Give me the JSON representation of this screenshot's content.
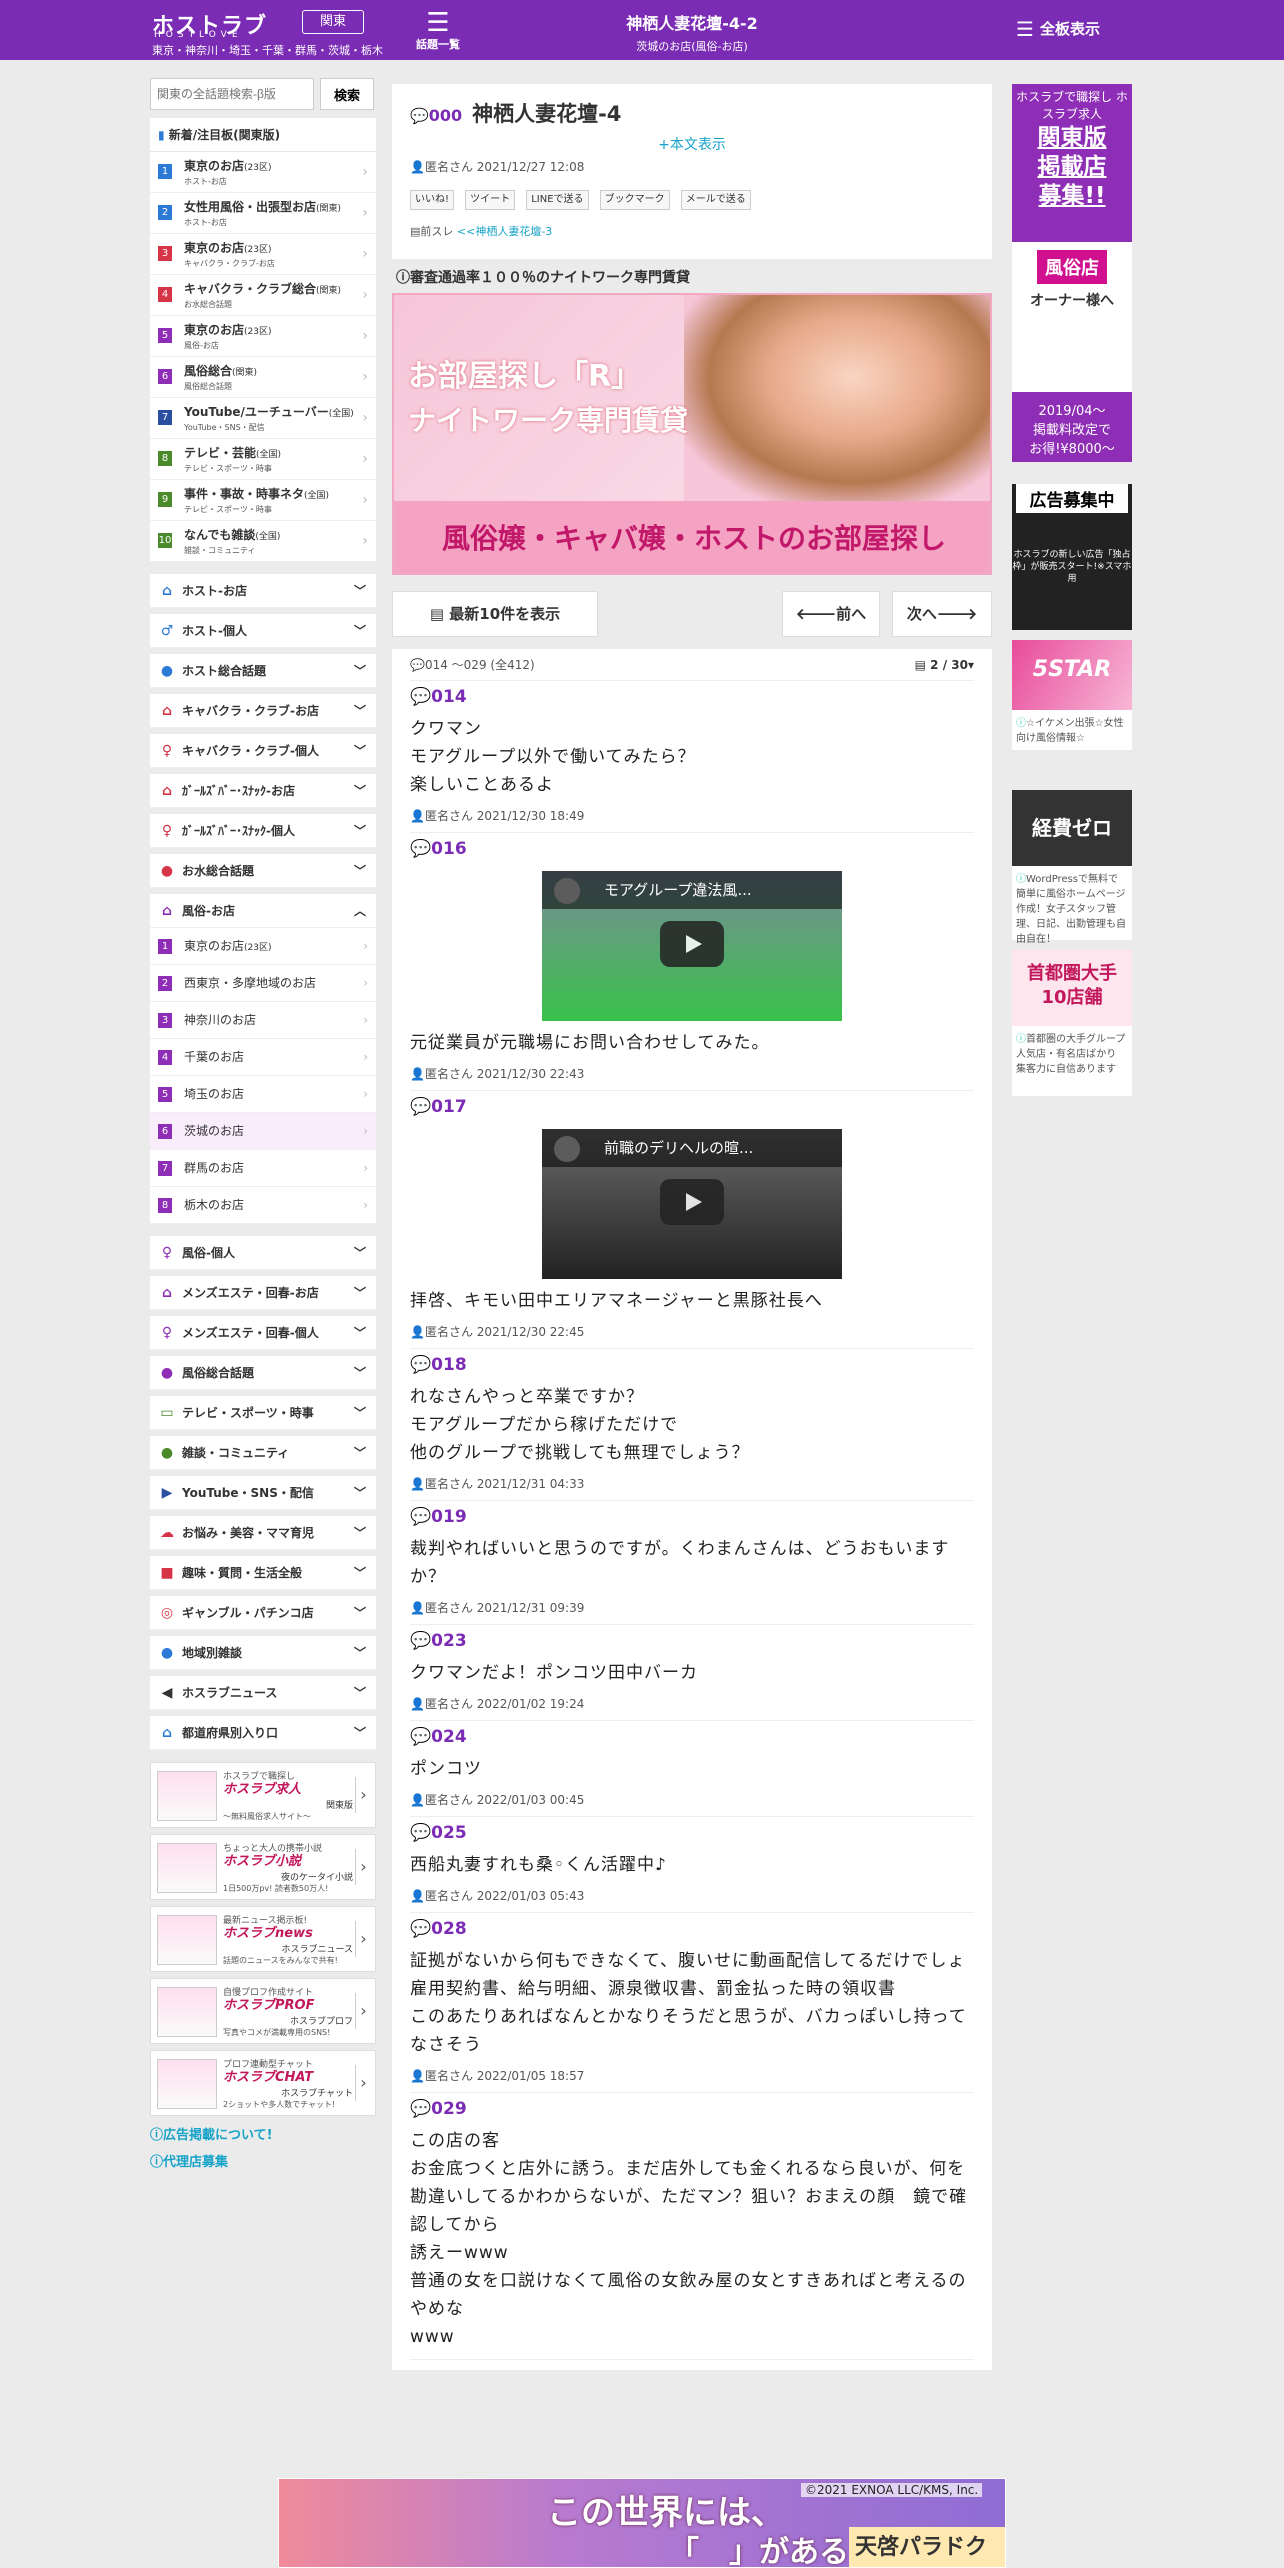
{
  "header": {
    "logo": "ホストラブ",
    "logo_sub": "HOSTLOVE",
    "region": "関東",
    "areas": "東京・神奈川・埼玉・千葉・群馬・茨城・栃木",
    "topics_label": "話題一覧",
    "page_title": "神栖人妻花壇-4-2",
    "page_subtitle": "茨城のお店(風俗-お店)",
    "full_label": "全板表示",
    "bg_color": "#7b2cb4"
  },
  "sidebar": {
    "search_placeholder": "関東の全話題検索-β版",
    "search_button": "検索",
    "hot_title": "新着/注目板(関東版)",
    "hot_items": [
      {
        "num": "1",
        "name": "東京のお店",
        "small": "(23区)",
        "desc": "ホスト-お店",
        "color": "#2a7ad6"
      },
      {
        "num": "2",
        "name": "女性用風俗・出張型お店",
        "small": "(関東)",
        "desc": "ホスト-お店",
        "color": "#2a7ad6"
      },
      {
        "num": "3",
        "name": "東京のお店",
        "small": "(23区)",
        "desc": "キャバクラ・クラブ-お店",
        "color": "#d63447"
      },
      {
        "num": "4",
        "name": "キャバクラ・クラブ総合",
        "small": "(関東)",
        "desc": "お水総合話題",
        "color": "#d63447"
      },
      {
        "num": "5",
        "name": "東京のお店",
        "small": "(23区)",
        "desc": "風俗-お店",
        "color": "#8e2db5"
      },
      {
        "num": "6",
        "name": "風俗総合",
        "small": "(関東)",
        "desc": "風俗総合話題",
        "color": "#8e2db5"
      },
      {
        "num": "7",
        "name": "YouTube/ユーチューバー",
        "small": "(全国)",
        "desc": "YouTube・SNS・配信",
        "color": "#2a4fa0"
      },
      {
        "num": "8",
        "name": "テレビ・芸能",
        "small": "(全国)",
        "desc": "テレビ・スポーツ・時事",
        "color": "#4b8a2a"
      },
      {
        "num": "9",
        "name": "事件・事故・時事ネタ",
        "small": "(全国)",
        "desc": "テレビ・スポーツ・時事",
        "color": "#4b8a2a"
      },
      {
        "num": "10",
        "name": "なんでも雑談",
        "small": "(全国)",
        "desc": "雑談・コミュニティ",
        "color": "#4b8a2a"
      }
    ],
    "cats_a": [
      {
        "name": "ホスト-お店",
        "icon": "⌂",
        "color": "#2a7ad6"
      },
      {
        "name": "ホスト-個人",
        "icon": "♂",
        "color": "#2a7ad6"
      },
      {
        "name": "ホスト総合話題",
        "icon": "●",
        "color": "#2a7ad6"
      },
      {
        "name": "キャバクラ・クラブ-お店",
        "icon": "⌂",
        "color": "#d63447"
      },
      {
        "name": "キャバクラ・クラブ-個人",
        "icon": "♀",
        "color": "#d63447"
      },
      {
        "name": "ｶﾞｰﾙｽﾞﾊﾞｰ･ｽﾅｯｸ-お店",
        "icon": "⌂",
        "color": "#d63447"
      },
      {
        "name": "ｶﾞｰﾙｽﾞﾊﾞｰ･ｽﾅｯｸ-個人",
        "icon": "♀",
        "color": "#d63447"
      },
      {
        "name": "お水総合話題",
        "icon": "●",
        "color": "#d63447"
      }
    ],
    "open_cat": {
      "name": "風俗-お店",
      "icon": "⌂",
      "color": "#8e2db5"
    },
    "sub_items": [
      {
        "num": "1",
        "name": "東京のお店",
        "small": "(23区)"
      },
      {
        "num": "2",
        "name": "西東京・多摩地域のお店",
        "small": ""
      },
      {
        "num": "3",
        "name": "神奈川のお店",
        "small": ""
      },
      {
        "num": "4",
        "name": "千葉のお店",
        "small": ""
      },
      {
        "num": "5",
        "name": "埼玉のお店",
        "small": ""
      },
      {
        "num": "6",
        "name": "茨城のお店",
        "small": ""
      },
      {
        "num": "7",
        "name": "群馬のお店",
        "small": ""
      },
      {
        "num": "8",
        "name": "栃木のお店",
        "small": ""
      }
    ],
    "cats_b": [
      {
        "name": "風俗-個人",
        "icon": "♀",
        "color": "#8e2db5"
      },
      {
        "name": "メンズエステ・回春-お店",
        "icon": "⌂",
        "color": "#8e2db5"
      },
      {
        "name": "メンズエステ・回春-個人",
        "icon": "♀",
        "color": "#8e2db5"
      },
      {
        "name": "風俗総合話題",
        "icon": "●",
        "color": "#8e2db5"
      },
      {
        "name": "テレビ・スポーツ・時事",
        "icon": "▭",
        "color": "#4b8a2a"
      },
      {
        "name": "雑談・コミュニティ",
        "icon": "●",
        "color": "#4b8a2a"
      },
      {
        "name": "YouTube・SNS・配信",
        "icon": "▶",
        "color": "#2a4fa0"
      },
      {
        "name": "お悩み・美容・ママ育児",
        "icon": "☁",
        "color": "#d63447"
      },
      {
        "name": "趣味・質問・生活全般",
        "icon": "■",
        "color": "#d63447"
      },
      {
        "name": "ギャンブル・パチンコ店",
        "icon": "◎",
        "color": "#d63447"
      },
      {
        "name": "地域別雑談",
        "icon": "●",
        "color": "#2a7ad6"
      },
      {
        "name": "ホスラブニュース",
        "icon": "◀",
        "color": "#333333"
      },
      {
        "name": "都道府県別入り口",
        "icon": "⌂",
        "color": "#2a7ad6"
      }
    ],
    "promos": [
      {
        "top": "ホスラブで職探し",
        "brand": "ホスラブ求人",
        "right": "関東版",
        "desc": "〜無料風俗求人サイト〜"
      },
      {
        "top": "ちょっと大人の携帯小説",
        "brand": "ホスラブ小説",
        "right": "夜のケータイ小説",
        "desc": "1日500万pv! 読者数50万人!"
      },
      {
        "top": "最新ニュース掲示板!",
        "brand": "ホスラブnews",
        "right": "ホスラブニュース",
        "desc": "話題のニュースをみんなで共有!"
      },
      {
        "top": "自慢プロフ作成サイト",
        "brand": "ホスラブPROF",
        "right": "ホスラブプロフ",
        "desc": "写真やコメが満載専用のSNS!"
      },
      {
        "top": "プロフ連動型チャット",
        "brand": "ホスラブCHAT",
        "right": "ホスラブチャット",
        "desc": "2ショットや多人数でチャット!"
      }
    ],
    "links": [
      "広告掲載について!",
      "代理店募集"
    ]
  },
  "thread": {
    "no": "000",
    "title": "神栖人妻花壇-4",
    "body_toggle": "+本文表示",
    "author": "匿名さん",
    "date": "2021/12/27 12:08",
    "share": [
      "いいね!",
      "ツイート",
      "LINEで送る",
      "ブックマーク",
      "メールで送る"
    ],
    "prev_label": "前スレ",
    "prev_link": "<<神栖人妻花壇-3"
  },
  "ad": {
    "title": "審査通過率１００％のナイトワーク専門賃貸",
    "line1": "お部屋探し「R」",
    "line2": "ナイトワーク専門賃貸",
    "band": "風俗嬢・キャバ嬢・ホストのお部屋探し"
  },
  "nav": {
    "latest": "最新10件を表示",
    "prev": "前へ",
    "next": "次へ"
  },
  "replies_head": {
    "range": "014 ～029 (全412)",
    "page": "2 / 30"
  },
  "replies": [
    {
      "no": "014",
      "body": "クワマン\nモアグループ以外で働いてみたら？\n楽しいことあるよ",
      "author": "匿名さん",
      "date": "2021/12/30 18:49",
      "video": ""
    },
    {
      "no": "016",
      "body": "元従業員が元職場にお問い合わせしてみた。",
      "author": "匿名さん",
      "date": "2021/12/30 22:43",
      "video": "モアグループ違法風..."
    },
    {
      "no": "017",
      "body": "拝啓、キモい田中エリアマネージャーと黒豚社長へ",
      "author": "匿名さん",
      "date": "2021/12/30 22:45",
      "video": "前職のデリヘルの暄..."
    },
    {
      "no": "018",
      "body": "れなさんやっと卒業ですか？\nモアグループだから稼げただけで\n他のグループで挑戦しても無理でしょう？",
      "author": "匿名さん",
      "date": "2021/12/31 04:33",
      "video": ""
    },
    {
      "no": "019",
      "body": "裁判やればいいと思うのですが。くわまんさんは、どうおもいますか？",
      "author": "匿名さん",
      "date": "2021/12/31 09:39",
      "video": ""
    },
    {
      "no": "023",
      "body": "クワマンだよ！ポンコツ田中バーカ",
      "author": "匿名さん",
      "date": "2022/01/02 19:24",
      "video": ""
    },
    {
      "no": "024",
      "body": "ポンコツ",
      "author": "匿名さん",
      "date": "2022/01/03 00:45",
      "video": ""
    },
    {
      "no": "025",
      "body": "西船丸妻すれも桑◦くん活躍中♪",
      "author": "匿名さん",
      "date": "2022/01/03 05:43",
      "video": ""
    },
    {
      "no": "028",
      "body": "証拠がないから何もできなくて、腹いせに動画配信してるだけでしょ\n雇用契約書、給与明細、源泉徴収書、罰金払った時の領収書\nこのあたりあればなんとかなりそうだと思うが、バカっぽいし持ってなさそう",
      "author": "匿名さん",
      "date": "2022/01/05 18:57",
      "video": ""
    },
    {
      "no": "029",
      "body": "この店の客\nお金底つくと店外に誘う。まだ店外しても金くれるなら良いが、何を勘違いしてるかわからないが、ただマン？狙い？おまえの顔　鏡で確認してから\n誘えーwww\n普通の女を口説けなくて風俗の女飲み屋の女とすきあればと考えるのやめな\nwww",
      "author": "",
      "date": "",
      "video": ""
    }
  ],
  "right_ads": {
    "a_top": "ホスラブで職探し ホスラブ求人",
    "a_main": "関東版\n掲載店\n募集!!",
    "a_sign": "風俗店",
    "a_owner": "オーナー様へ",
    "a_foot": "2019/04〜\n掲載料改定で\nお得!¥8000〜",
    "b_head": "広告募集中",
    "b_txt": "ホスラブの新しい広告「独占枠」が販売スタート!※スマホ用",
    "c_img": "5STAR",
    "c_txt": "☆イケメン出張☆女性向け風俗情報☆",
    "d_img": "経費ゼロ",
    "d_txt": "WordPressで無料で簡単に風俗ホームページ作成！女子スタッフ管理、日記、出勤管理も自由自在！",
    "e_img": "首都圏大手\n10店舗",
    "e_txt": "首都圏の大手グループ 人気店・有名店ばかり 集客力に自信あります"
  },
  "bottom_ad": {
    "copy": "©2021 EXNOA LLC/KMS, Inc.",
    "line1": "この世界には、",
    "line2": "「　」がある",
    "logo": "天啓パラドクスX"
  }
}
